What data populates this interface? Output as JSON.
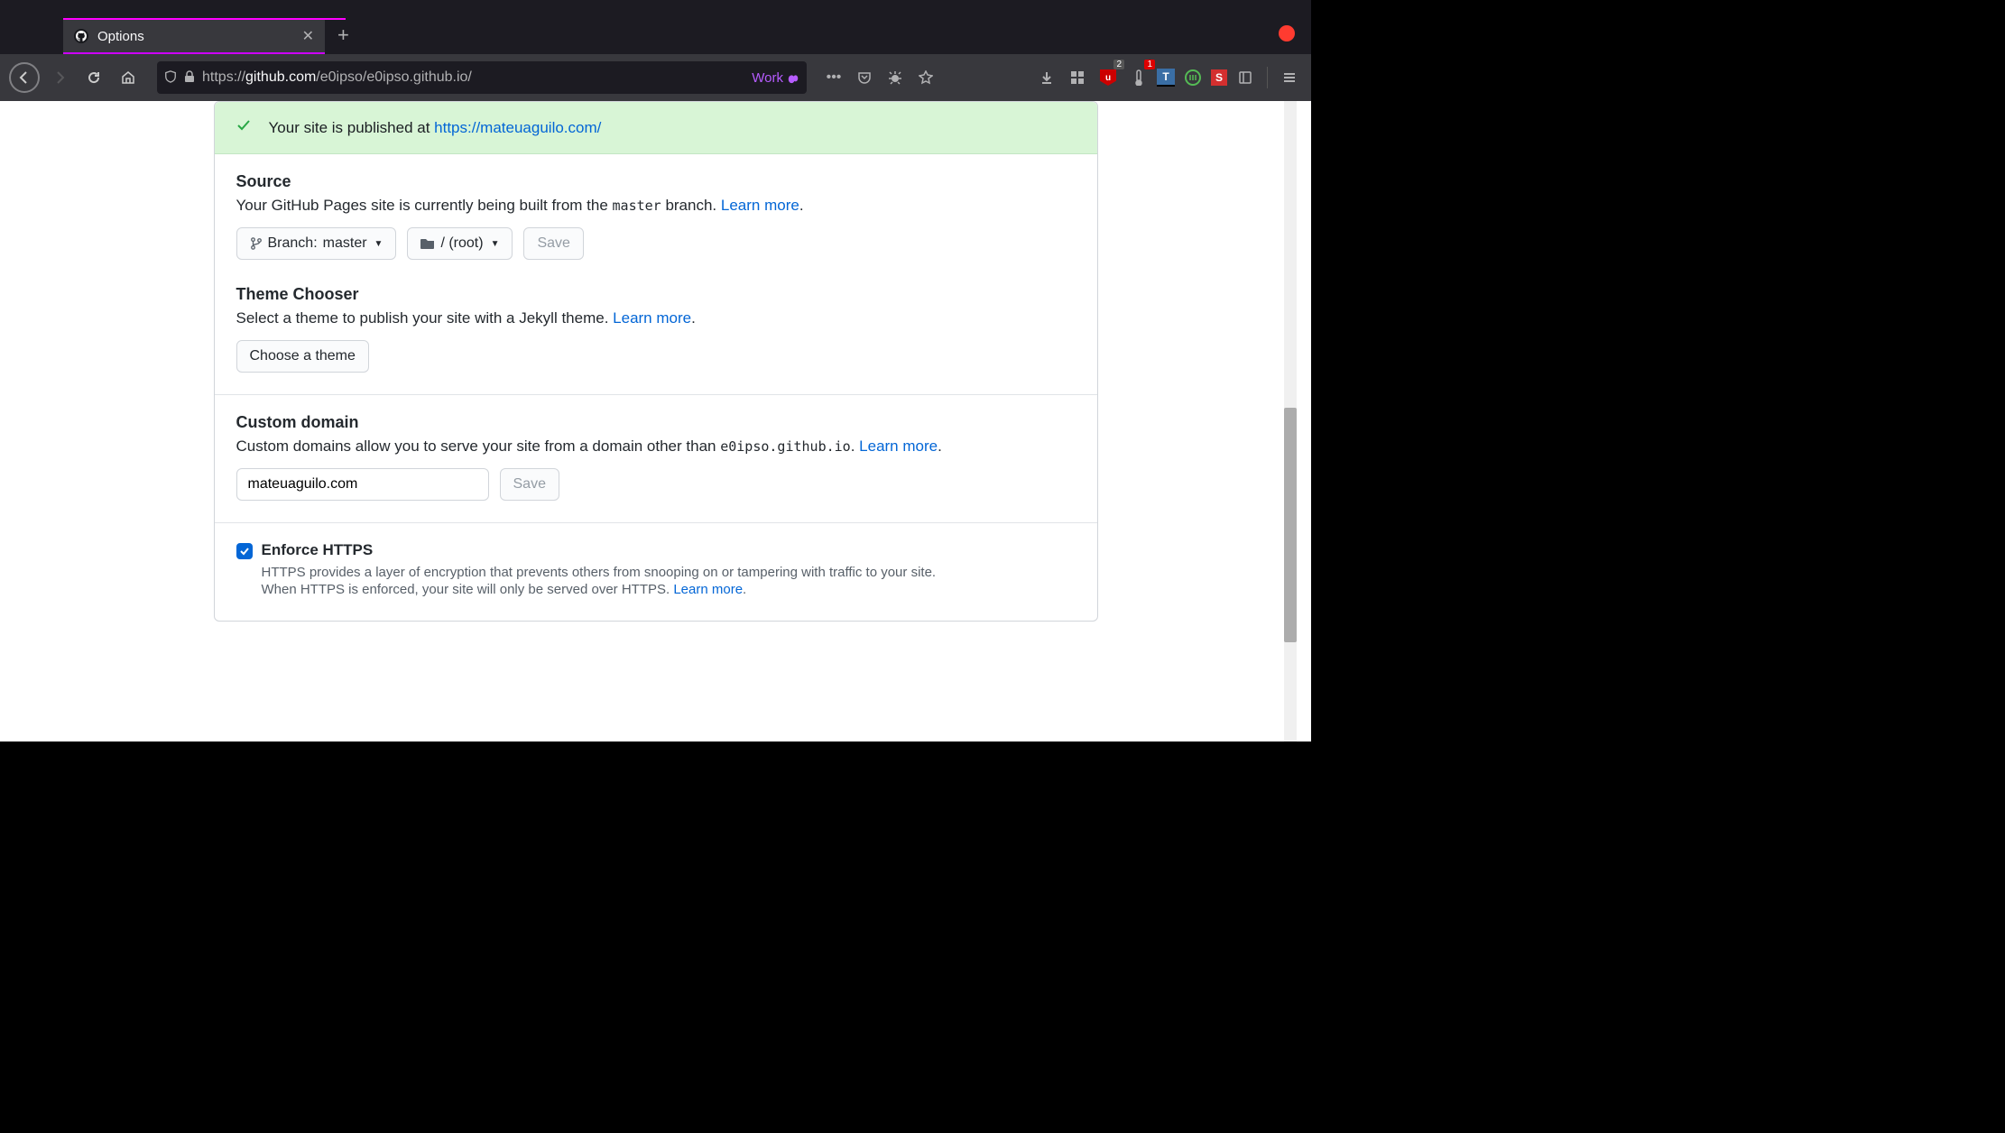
{
  "browser": {
    "tab_title": "Options",
    "url_prefix": "https://",
    "url_host": "github.com",
    "url_path": "/e0ipso/e0ipso.github.io/",
    "container_label": "Work",
    "ublock_badge": "2",
    "thermo_badge": "1"
  },
  "flash": {
    "prefix": "Your site is published at ",
    "link": "https://mateuaguilo.com/"
  },
  "source": {
    "title": "Source",
    "desc_prefix": "Your GitHub Pages site is currently being built from the ",
    "desc_branch": "master",
    "desc_suffix": " branch. ",
    "learn_more": "Learn more",
    "branch_label": "Branch: ",
    "branch_value": "master",
    "folder_value": "/ (root)",
    "save_label": "Save"
  },
  "theme": {
    "title": "Theme Chooser",
    "desc": "Select a theme to publish your site with a Jekyll theme. ",
    "learn_more": "Learn more",
    "button": "Choose a theme"
  },
  "domain": {
    "title": "Custom domain",
    "desc_prefix": "Custom domains allow you to serve your site from a domain other than ",
    "desc_code": "e0ipso.github.io",
    "desc_suffix": ". ",
    "learn_more": "Learn more",
    "input_value": "mateuaguilo.com",
    "save_label": "Save"
  },
  "https": {
    "title": "Enforce HTTPS",
    "line1": "HTTPS provides a layer of encryption that prevents others from snooping on or tampering with traffic to your site.",
    "line2_prefix": "When HTTPS is enforced, your site will only be served over HTTPS. ",
    "learn_more": "Learn more"
  }
}
